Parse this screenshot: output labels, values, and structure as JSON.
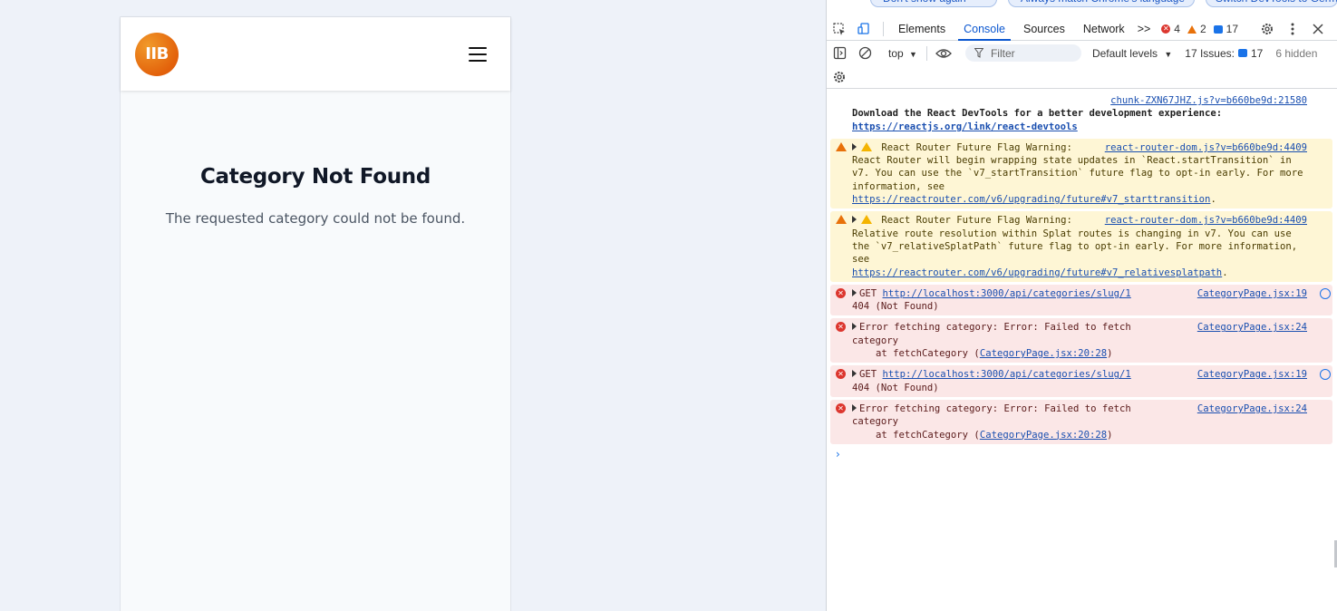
{
  "app": {
    "logo_text": "IIB",
    "heading": "Category Not Found",
    "message": "The requested category could not be found."
  },
  "devtools": {
    "notification_buttons": [
      "Don't show again",
      "Always match Chrome's language",
      "Switch DevTools to German"
    ],
    "tabs": [
      "Elements",
      "Console",
      "Sources",
      "Network"
    ],
    "active_tab": "Console",
    "more_tabs": ">>",
    "error_count": "4",
    "warning_count": "2",
    "info_count": "17",
    "context": "top",
    "filter_placeholder": "Filter",
    "levels": "Default levels",
    "issues_label": "17 Issues:",
    "issues_count": "17",
    "hidden_label": "6 hidden",
    "messages": {
      "m1": {
        "source": "chunk-ZXN67JHZ.js?v=b660be9d:21580",
        "text": "Download the React DevTools for a better development experience:",
        "link": "https://reactjs.org/link/react-devtools"
      },
      "m2": {
        "source": "react-router-dom.js?v=b660be9d:4409",
        "title": "React Router Future Flag Warning:",
        "body": "React Router will begin wrapping state updates in `React.startTransition` in v7. You can use the `v7_startTransition` future flag to opt-in early. For more information, see",
        "link": "https://reactrouter.com/v6/upgrading/future#v7_starttransition"
      },
      "m3": {
        "source": "react-router-dom.js?v=b660be9d:4409",
        "title": "React Router Future Flag Warning:",
        "body": "Relative route resolution within Splat routes is changing in v7. You can use the `v7_relativeSplatPath` future flag to opt-in early. For more information, see",
        "link": "https://reactrouter.com/v6/upgrading/future#v7_relativesplatpath"
      },
      "m4": {
        "source": "CategoryPage.jsx:19",
        "method": "GET",
        "url": "http://localhost:3000/api/categories/slug/1",
        "status": "404 (Not Found)"
      },
      "m5": {
        "source": "CategoryPage.jsx:24",
        "line1": "Error fetching category: Error: Failed to fetch",
        "line2": "category",
        "at": "at fetchCategory (",
        "at_link": "CategoryPage.jsx:20:28",
        "close": ")"
      },
      "m6": {
        "source": "CategoryPage.jsx:19",
        "method": "GET",
        "url": "http://localhost:3000/api/categories/slug/1",
        "status": "404 (Not Found)"
      },
      "m7": {
        "source": "CategoryPage.jsx:24",
        "line1": "Error fetching category: Error: Failed to fetch",
        "line2": "category",
        "at": "at fetchCategory (",
        "at_link": "CategoryPage.jsx:20:28",
        "close": ")"
      }
    },
    "period": ".",
    "prompt": "›"
  }
}
